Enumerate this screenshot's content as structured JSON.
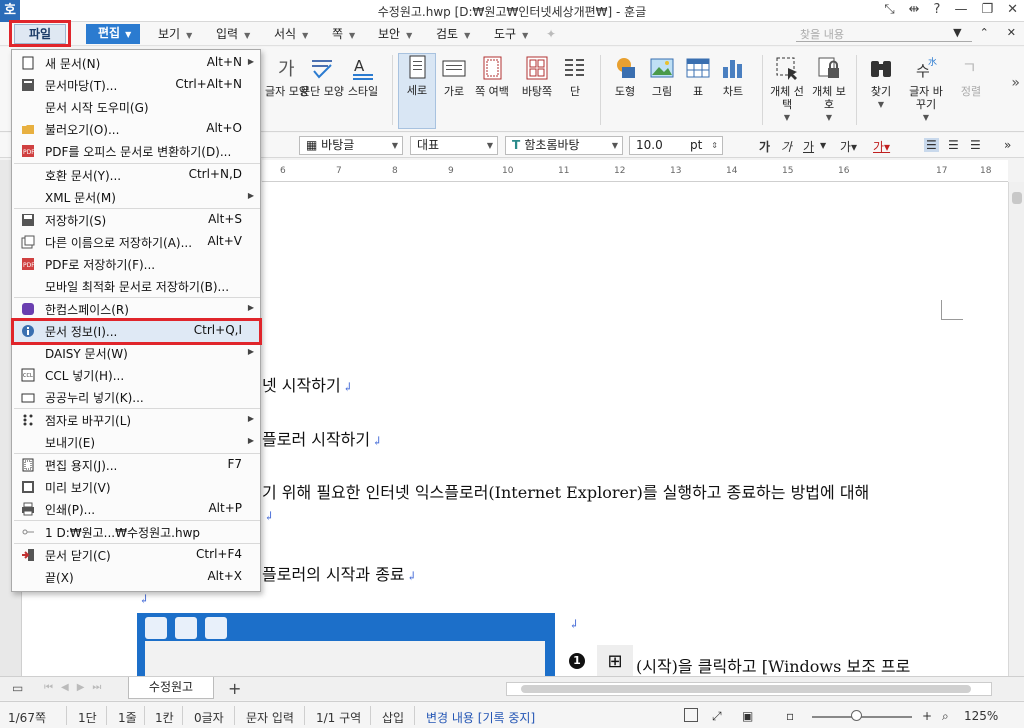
{
  "titlebar": {
    "logo": "호",
    "title": "수정원고.hwp [D:₩원고₩인터넷세상개편₩] - 훈글"
  },
  "menubar": {
    "file": "파일",
    "edit": "편집",
    "view": "보기",
    "input": "입력",
    "format": "서식",
    "page": "쪽",
    "security": "보안",
    "review": "검토",
    "tools": "도구",
    "search_placeholder": "찾을 내용"
  },
  "ribbon": {
    "char_shape": "글자 모양",
    "para_shape": "문단 모양",
    "style": "스타일",
    "portrait": "세로",
    "landscape": "가로",
    "page_margin": "쪽 여백",
    "background": "바탕쪽",
    "columns": "단",
    "shape": "도형",
    "picture": "그림",
    "table": "표",
    "chart": "차트",
    "select_object": "개체 선택",
    "protect_object": "개체 보호",
    "find": "찾기",
    "replace_char": "글자 바꾸기",
    "align": "정렬"
  },
  "formatbar": {
    "style_name": "바탕글",
    "lang": "대표",
    "font": "함초롬바탕",
    "size": "10.0",
    "unit": "pt",
    "bold": "가",
    "italic": "가",
    "underline": "가"
  },
  "ruler": {
    "ticks": [
      "6",
      "7",
      "8",
      "9",
      "10",
      "11",
      "12",
      "13",
      "14",
      "15",
      "16",
      "17",
      "18"
    ]
  },
  "document": {
    "line1": "넷 시작하기",
    "line2": "플로러 시작하기",
    "line3": "기 위해 필요한 인터넷 익스플로러(Internet Explorer)를 실행하고 종료하는 방법에 대해",
    "line4": "플로러의 시작과 종료",
    "line5": "(시작)을 클릭하고 [Windows 보조 프로",
    "badge": "1",
    "return_mark": "↲"
  },
  "tabbar": {
    "tab": "수정원고",
    "add": "+"
  },
  "statusbar": {
    "page": "1/67쪽",
    "column": "1단",
    "line": "1줄",
    "col": "1칸",
    "chars": "0글자",
    "mode": "문자 입력",
    "section": "1/1 구역",
    "insert": "삽입",
    "track": "변경 내용 [기록 중지]",
    "zoom": "125%"
  },
  "file_menu": [
    {
      "label": "새 문서(N)",
      "shortcut": "Alt+N",
      "sub": true
    },
    {
      "label": "문서마당(T)...",
      "shortcut": "Ctrl+Alt+N",
      "sub": false
    },
    {
      "label": "문서 시작 도우미(G)",
      "shortcut": "",
      "sub": false
    },
    {
      "label": "불러오기(O)...",
      "shortcut": "Alt+O",
      "sub": false
    },
    {
      "label": "PDF를 오피스 문서로 변환하기(D)...",
      "shortcut": "",
      "sub": false
    },
    {
      "label": "호환 문서(Y)...",
      "shortcut": "Ctrl+N,D",
      "sub": false
    },
    {
      "label": "XML 문서(M)",
      "shortcut": "",
      "sub": true
    },
    {
      "label": "저장하기(S)",
      "shortcut": "Alt+S",
      "sub": false
    },
    {
      "label": "다른 이름으로 저장하기(A)...",
      "shortcut": "Alt+V",
      "sub": false
    },
    {
      "label": "PDF로 저장하기(F)...",
      "shortcut": "",
      "sub": false
    },
    {
      "label": "모바일 최적화 문서로 저장하기(B)...",
      "shortcut": "",
      "sub": false
    },
    {
      "label": "한컴스페이스(R)",
      "shortcut": "",
      "sub": true
    },
    {
      "label": "문서 정보(I)...",
      "shortcut": "Ctrl+Q,I",
      "sub": false
    },
    {
      "label": "DAISY 문서(W)",
      "shortcut": "",
      "sub": true
    },
    {
      "label": "CCL 넣기(H)...",
      "shortcut": "",
      "sub": false
    },
    {
      "label": "공공누리 넣기(K)...",
      "shortcut": "",
      "sub": false
    },
    {
      "label": "점자로 바꾸기(L)",
      "shortcut": "",
      "sub": true
    },
    {
      "label": "보내기(E)",
      "shortcut": "",
      "sub": true
    },
    {
      "label": "편집 용지(J)...",
      "shortcut": "F7",
      "sub": false
    },
    {
      "label": "미리 보기(V)",
      "shortcut": "",
      "sub": false
    },
    {
      "label": "인쇄(P)...",
      "shortcut": "Alt+P",
      "sub": false
    },
    {
      "label": "1 D:₩원고...₩수정원고.hwp",
      "shortcut": "",
      "sub": false
    },
    {
      "label": "문서 닫기(C)",
      "shortcut": "Ctrl+F4",
      "sub": false
    },
    {
      "label": "끝(X)",
      "shortcut": "Alt+X",
      "sub": false
    }
  ]
}
